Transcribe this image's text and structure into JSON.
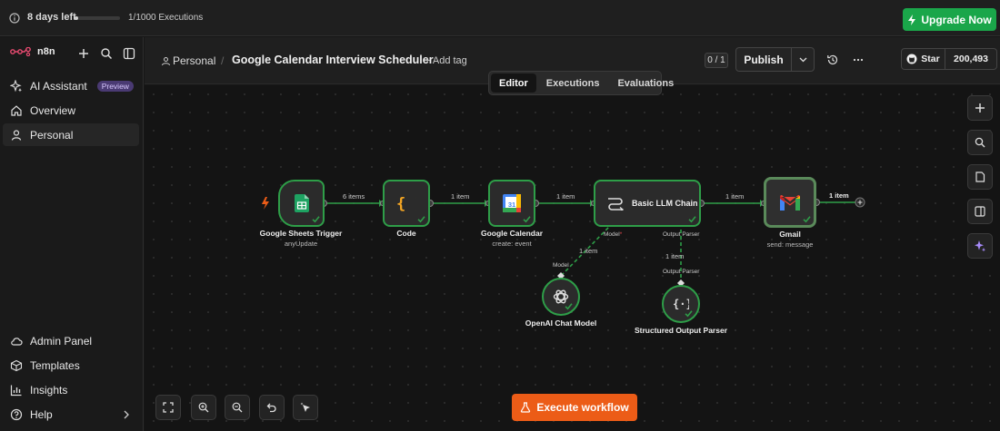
{
  "trial": {
    "days_left": "8 days left",
    "executions": "1/1000 Executions",
    "executions_fraction": 0.001
  },
  "upgrade": {
    "label": "Upgrade Now",
    "color": "#1aa64a"
  },
  "sidebar": {
    "logo": "n8n",
    "items": [
      {
        "label": "AI Assistant",
        "badge": "Preview",
        "icon": "sparkles-icon"
      },
      {
        "label": "Overview",
        "icon": "home-icon"
      },
      {
        "label": "Personal",
        "icon": "user-icon"
      }
    ],
    "bottom_items": [
      {
        "label": "Admin Panel",
        "icon": "cloud-icon"
      },
      {
        "label": "Templates",
        "icon": "box-icon"
      },
      {
        "label": "Insights",
        "icon": "chart-icon"
      },
      {
        "label": "Help",
        "icon": "help-icon"
      }
    ]
  },
  "header": {
    "breadcrumb": "Personal",
    "separator": "/",
    "title": "Google Calendar Interview Scheduler",
    "add_tag": "+ Add tag",
    "version": "0 / 1",
    "publish": "Publish",
    "github_star": "Star",
    "github_count": "200,493"
  },
  "tabs": [
    "Editor",
    "Executions",
    "Evaluations"
  ],
  "nodes": {
    "sheets": {
      "label": "Google Sheets Trigger",
      "sub": "anyUpdate"
    },
    "code": {
      "label": "Code"
    },
    "calendar": {
      "label": "Google Calendar",
      "sub": "create: event"
    },
    "llm": {
      "label": "Basic LLM Chain"
    },
    "gmail": {
      "label": "Gmail",
      "sub": "send: message"
    },
    "openai": {
      "label": "OpenAI Chat Model"
    },
    "parser": {
      "label": "Structured Output Parser"
    }
  },
  "edges": {
    "sheets_code": "6 items",
    "code_calendar": "1 item",
    "calendar_llm": "1 item",
    "llm_gmail": "1 item",
    "gmail_out": "1 item",
    "openai_llm": "1 item",
    "parser_llm": "1 item"
  },
  "ports": {
    "model": "Model",
    "model_required": "*",
    "output_parser": "Output Parser",
    "model_bottom": "Model",
    "output_parser_bottom": "Output Parser"
  },
  "execute": {
    "label": "Execute workflow",
    "color": "#ec5c17"
  },
  "colors": {
    "success": "#2e9e48",
    "canvas": "#141414"
  }
}
